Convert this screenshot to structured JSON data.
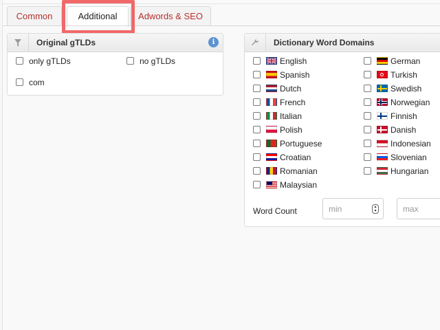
{
  "tabs": [
    {
      "label": "Common",
      "active": false
    },
    {
      "label": "Additional",
      "active": true
    },
    {
      "label": "Adwords & SEO",
      "active": false
    }
  ],
  "gtld_panel": {
    "title": "Original gTLDs",
    "icon": "filter-icon",
    "options": [
      {
        "label": "only gTLDs",
        "checked": false
      },
      {
        "label": "no gTLDs",
        "checked": false
      },
      {
        "label": "com",
        "checked": false
      }
    ]
  },
  "dict_panel": {
    "title": "Dictionary Word Domains",
    "icon": "wrench-icon",
    "languages_left": [
      "English",
      "Spanish",
      "Dutch",
      "French",
      "Italian",
      "Polish",
      "Portuguese",
      "Croatian",
      "Romanian",
      "Malaysian"
    ],
    "languages_right": [
      "German",
      "Turkish",
      "Swedish",
      "Norwegian",
      "Finnish",
      "Danish",
      "Indonesian",
      "Slovenian",
      "Hungarian"
    ],
    "word_count": {
      "label": "Word Count",
      "min_placeholder": "min",
      "max_placeholder": "max"
    }
  }
}
